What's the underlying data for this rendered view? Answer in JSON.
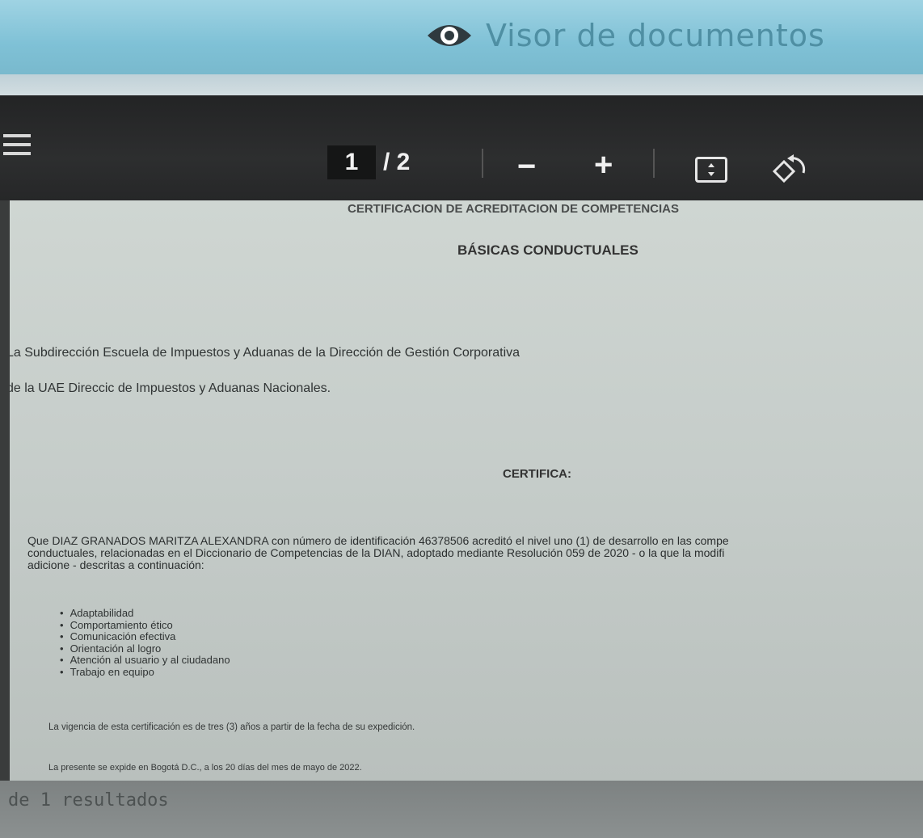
{
  "header": {
    "title": "Visor de documentos",
    "icon": "eye-icon"
  },
  "toolbar": {
    "menu_icon": "menu-icon",
    "current_page": "1",
    "page_total": "/ 2",
    "zoom_out_label": "−",
    "zoom_in_label": "+",
    "fit_icon": "fit-page-icon",
    "rotate_icon": "rotate-icon"
  },
  "document": {
    "title_line1": "CERTIFICACION DE ACREDITACION DE COMPETENCIAS",
    "title_line2": "BÁSICAS CONDUCTUALES",
    "intro_line1": "La Subdirección Escuela de Impuestos y Aduanas de la Dirección de Gestión Corporativa",
    "intro_line2": "de la UAE Direccic  de Impuestos y Aduanas Nacionales.",
    "certifica": "CERTIFICA:",
    "body_line1": "Que DIAZ GRANADOS MARITZA ALEXANDRA con número de identificación 46378506 acreditó el nivel uno (1) de desarrollo en las compe",
    "body_line2": "conductuales, relacionadas en el Diccionario de Competencias de la DIAN, adoptado mediante Resolución 059 de 2020 - o la que la modifi",
    "body_line3": "adicione - descritas a continuación:",
    "competencias": [
      "Adaptabilidad",
      "Comportamiento ético",
      "Comunicación efectiva",
      "Orientación al logro",
      "Atención al usuario y al ciudadano",
      "Trabajo en equipo"
    ],
    "vigencia": "La vigencia de esta certificación es de tres (3) años a partir de la fecha de su expedición.",
    "expedicion": "La presente se expide en Bogotá D.C., a los 20 días del mes de mayo de 2022."
  },
  "footer": {
    "results_text": "de 1 resultados"
  }
}
